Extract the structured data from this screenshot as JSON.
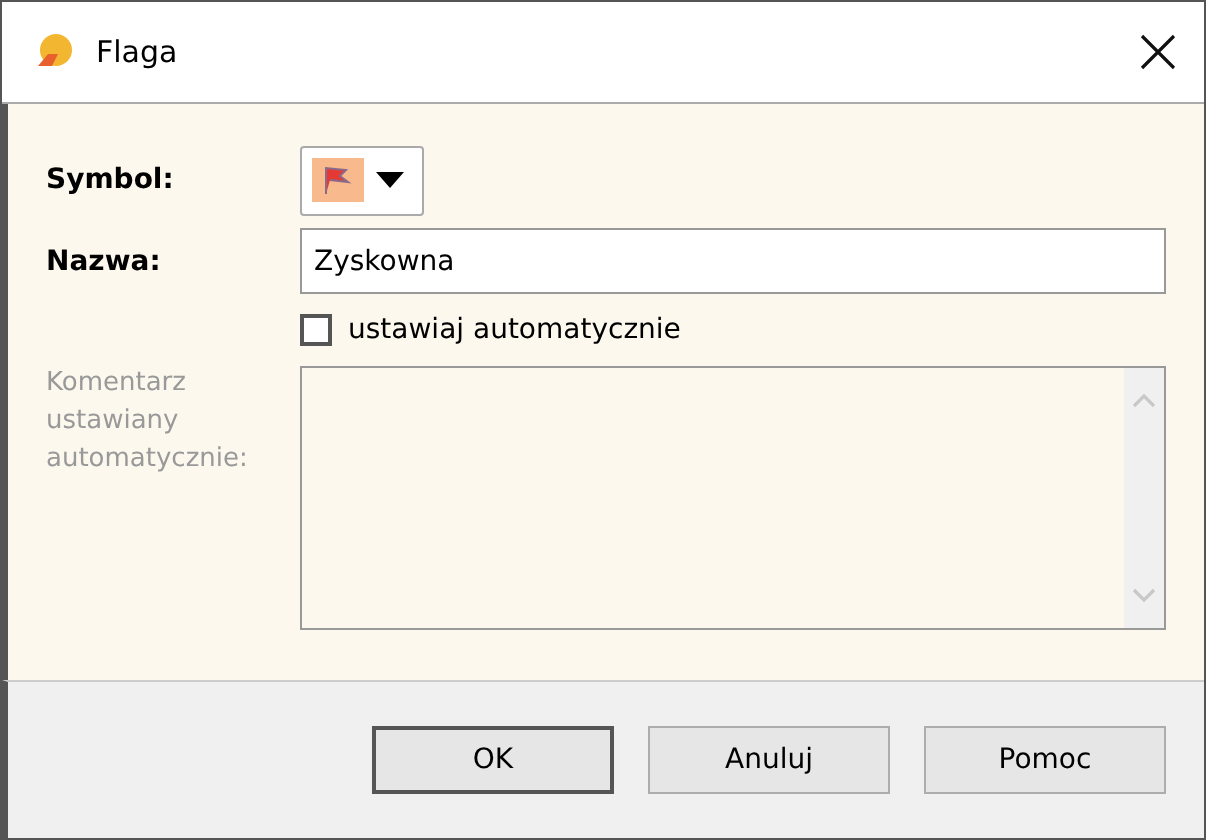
{
  "window": {
    "title": "Flaga"
  },
  "symbol": {
    "label": "Symbol:"
  },
  "name": {
    "label": "Nazwa:",
    "value": "Zyskowna"
  },
  "auto": {
    "label": "ustawiaj automatycznie",
    "checked": false
  },
  "comment": {
    "label": "Komentarz ustawiany automatycznie:",
    "disabled": true
  },
  "buttons": [
    {
      "label": "OK",
      "default": true
    },
    {
      "label": "Anuluj",
      "default": false
    },
    {
      "label": "Pomoc",
      "default": false
    }
  ]
}
